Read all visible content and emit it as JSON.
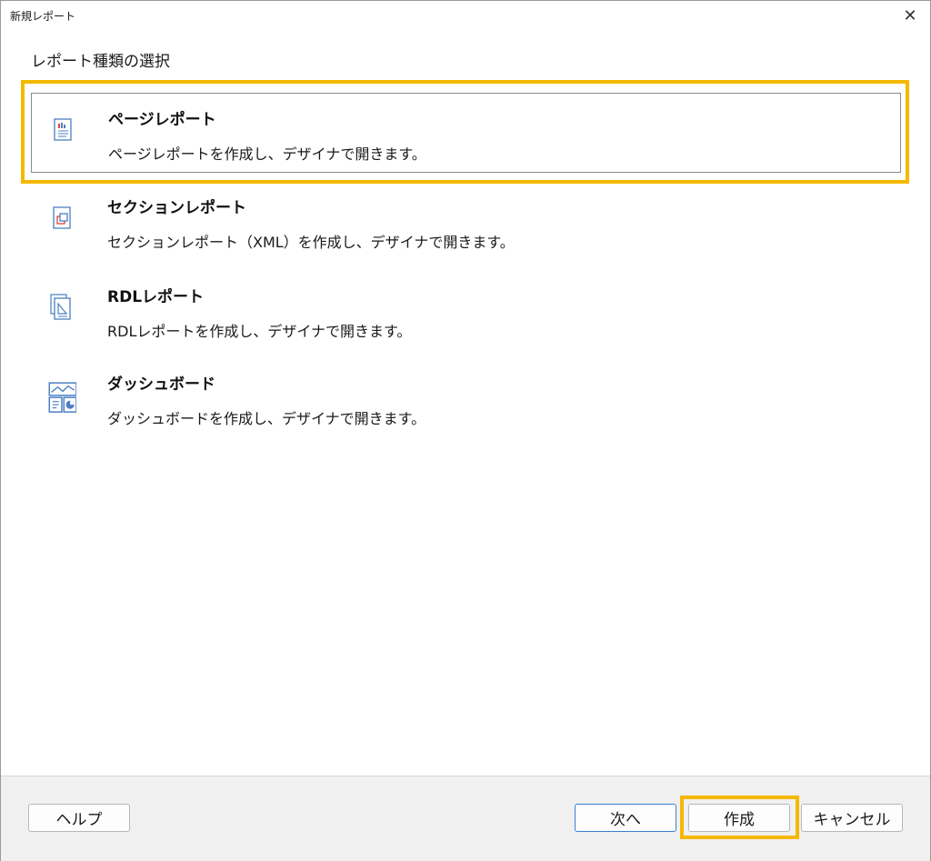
{
  "window": {
    "title": "新規レポート",
    "close_glyph": "✕"
  },
  "heading": "レポート種類の選択",
  "report_types": [
    {
      "title": "ページレポート",
      "description": "ページレポートを作成し、デザイナで開きます。",
      "icon": "page-report-icon",
      "selected": true
    },
    {
      "title": "セクションレポート",
      "description": "セクションレポート（XML）を作成し、デザイナで開きます。",
      "icon": "section-report-icon",
      "selected": false
    },
    {
      "title": "RDLレポート",
      "description": "RDLレポートを作成し、デザイナで開きます。",
      "icon": "rdl-report-icon",
      "selected": false
    },
    {
      "title": "ダッシュボード",
      "description": "ダッシュボードを作成し、デザイナで開きます。",
      "icon": "dashboard-icon",
      "selected": false
    }
  ],
  "buttons": {
    "help": "ヘルプ",
    "next": "次へ",
    "create": "作成",
    "cancel": "キャンセル"
  },
  "colors": {
    "highlight": "#f5b800",
    "icon_blue": "#4a7fc1",
    "icon_red": "#d9443a",
    "primary_border": "#3c7fd1"
  }
}
